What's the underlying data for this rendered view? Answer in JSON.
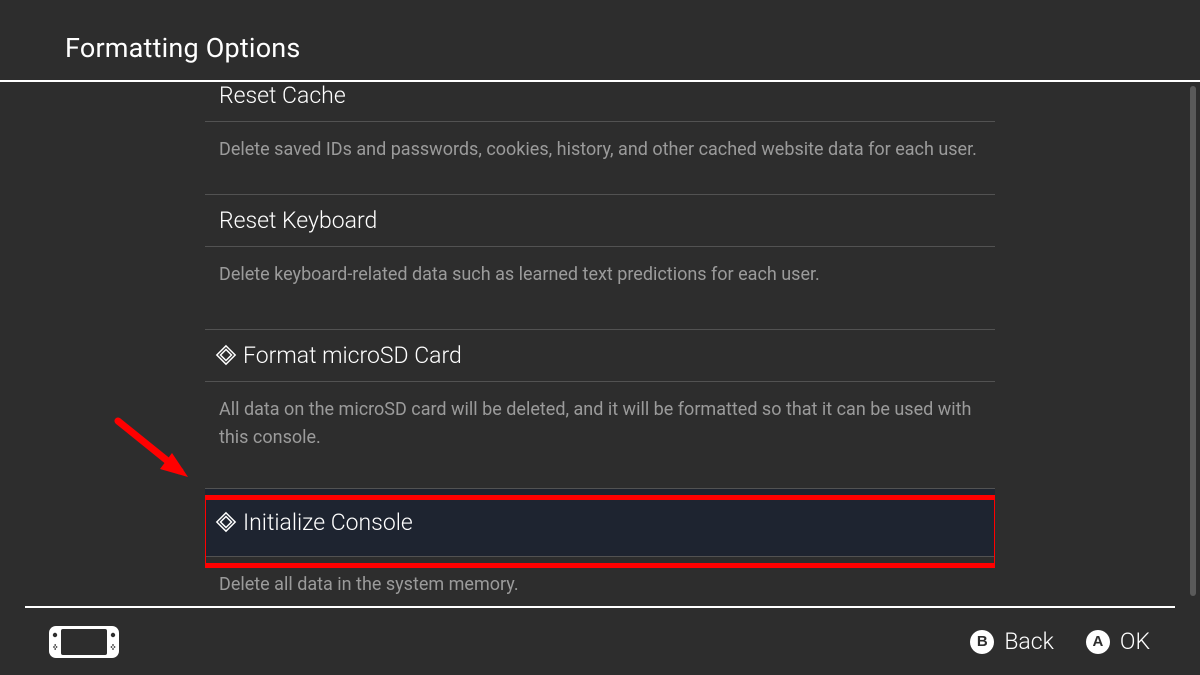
{
  "header": {
    "title": "Formatting Options"
  },
  "items": [
    {
      "title": "Reset Cache",
      "has_icon": false,
      "desc": "Delete saved IDs and passwords, cookies, history, and other cached website data for each user."
    },
    {
      "title": "Reset Keyboard",
      "has_icon": false,
      "desc": "Delete keyboard-related data such as learned text predictions for each user."
    },
    {
      "title": "Format microSD Card",
      "has_icon": true,
      "desc": "All data on the microSD card will be deleted, and it will be formatted so that it can be used with this console."
    },
    {
      "title": "Initialize Console",
      "has_icon": true,
      "desc": "Delete all data in the system memory."
    }
  ],
  "footer": {
    "back_label": "Back",
    "ok_label": "OK"
  },
  "annotation": {
    "highlighted_index": 3
  }
}
